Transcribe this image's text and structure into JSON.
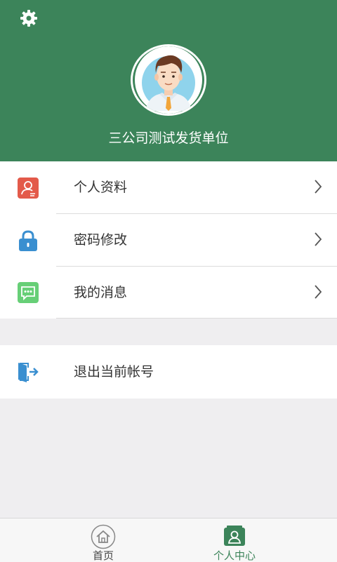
{
  "header": {
    "username": "三公司测试发货单位",
    "background_color": "#3c845a",
    "settings_icon": "gear-icon",
    "avatar_icon": "user-avatar-illustration"
  },
  "menu": {
    "items": [
      {
        "label": "个人资料",
        "icon": "profile-card-icon",
        "icon_color": "#e35a4a"
      },
      {
        "label": "密码修改",
        "icon": "lock-icon",
        "icon_color": "#3a8fd0"
      },
      {
        "label": "我的消息",
        "icon": "message-icon",
        "icon_color": "#67cf77"
      }
    ],
    "logout": {
      "label": "退出当前帐号",
      "icon": "logout-door-icon",
      "icon_color": "#3a8fd0"
    }
  },
  "tabbar": {
    "tabs": [
      {
        "label": "首页",
        "icon": "home-icon",
        "active": false
      },
      {
        "label": "个人中心",
        "icon": "person-center-icon",
        "active": true
      }
    ],
    "active_color": "#3c845a"
  }
}
